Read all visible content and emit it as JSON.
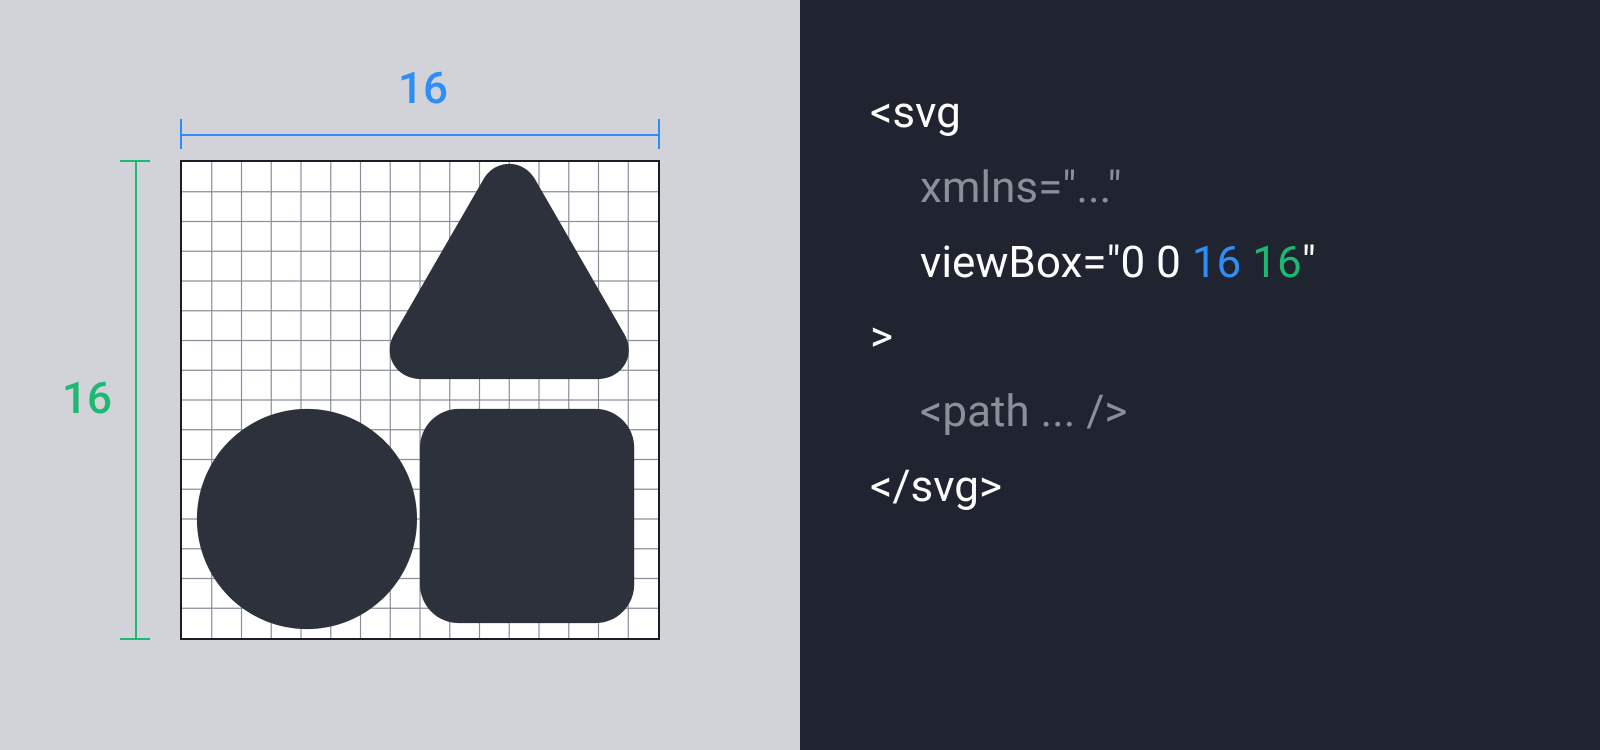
{
  "grid": {
    "width_label": "16",
    "height_label": "16",
    "cells": 16,
    "shape_fill": "#2c313c",
    "grid_line": "#8a8f9a"
  },
  "code": {
    "l1": "<svg",
    "l2": "xmlns=\"...\"",
    "l3_prefix": "viewBox=\"0 0 ",
    "l3_w": "16",
    "l3_sep": " ",
    "l3_h": "16",
    "l3_suffix": "\"",
    "l4": ">",
    "l5": "<path ... />",
    "l6": "</svg>"
  },
  "colors": {
    "left_bg": "#d2d2d9",
    "right_bg": "#1f2430",
    "width_dim": "#2e8ef7",
    "height_dim": "#1db872",
    "code_fg": "#fcfcfd",
    "code_dim": "#8a8f9a"
  }
}
